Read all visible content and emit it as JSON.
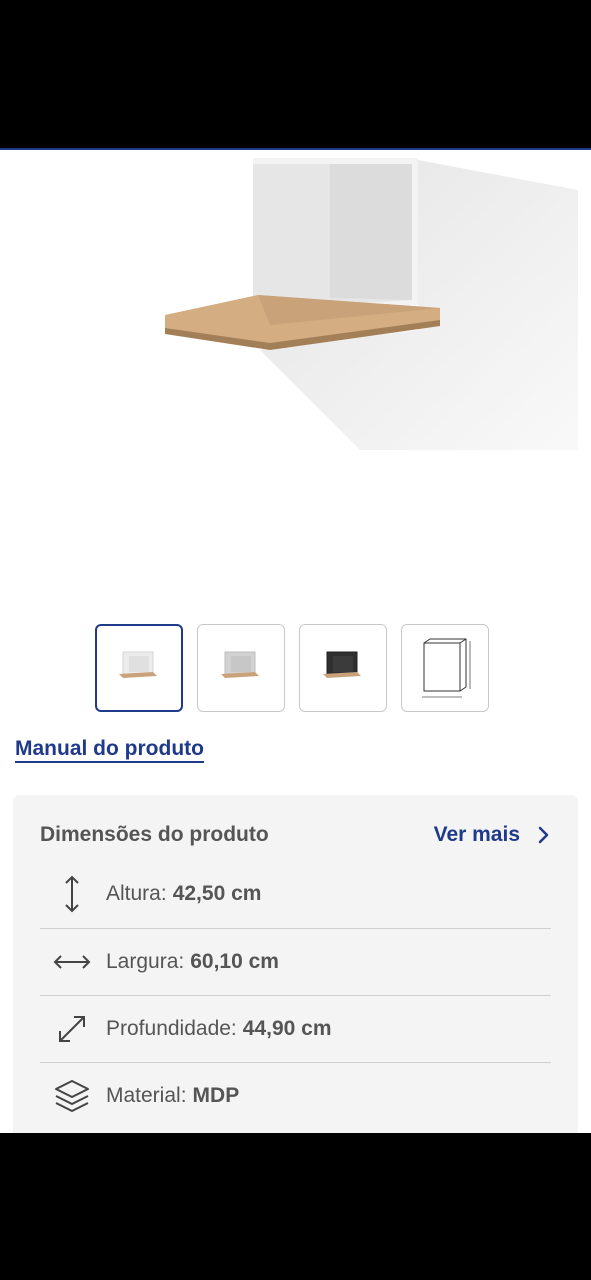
{
  "product": {
    "manual_link": "Manual do produto"
  },
  "thumbnails": [
    {
      "name": "thumb-white-niche"
    },
    {
      "name": "thumb-gray-niche"
    },
    {
      "name": "thumb-black-niche"
    },
    {
      "name": "thumb-dimensions-drawing"
    }
  ],
  "dimensions": {
    "title": "Dimensões do produto",
    "see_more": "Ver mais",
    "rows": [
      {
        "label": "Altura:",
        "value": "42,50 cm",
        "icon": "vertical-arrow-icon"
      },
      {
        "label": "Largura:",
        "value": "60,10 cm",
        "icon": "horizontal-arrow-icon"
      },
      {
        "label": "Profundidade:",
        "value": "44,90 cm",
        "icon": "diagonal-arrow-icon"
      },
      {
        "label": "Material:",
        "value": "MDP",
        "icon": "layers-icon"
      }
    ]
  },
  "colors": {
    "brand": "#1f3a8a",
    "card_bg": "#f4f4f4",
    "wood": "#c9a27a"
  }
}
